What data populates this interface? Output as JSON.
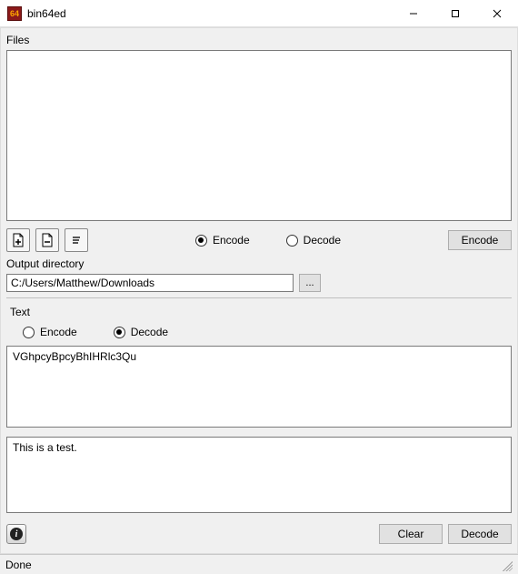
{
  "window": {
    "title": "bin64ed",
    "icon_text": "64"
  },
  "files": {
    "label": "Files",
    "radio_encode": "Encode",
    "radio_decode": "Decode",
    "radio_selected": "encode",
    "action_button": "Encode",
    "output_dir_label": "Output directory",
    "output_dir_value": "C:/Users/Matthew/Downloads",
    "browse": "..."
  },
  "text": {
    "label": "Text",
    "radio_encode": "Encode",
    "radio_decode": "Decode",
    "radio_selected": "decode",
    "input_value": "VGhpcyBpcyBhIHRlc3Qu",
    "output_value": "This is a test.",
    "clear_button": "Clear",
    "action_button": "Decode"
  },
  "status": {
    "text": "Done"
  },
  "icons": {
    "info_glyph": "i"
  }
}
